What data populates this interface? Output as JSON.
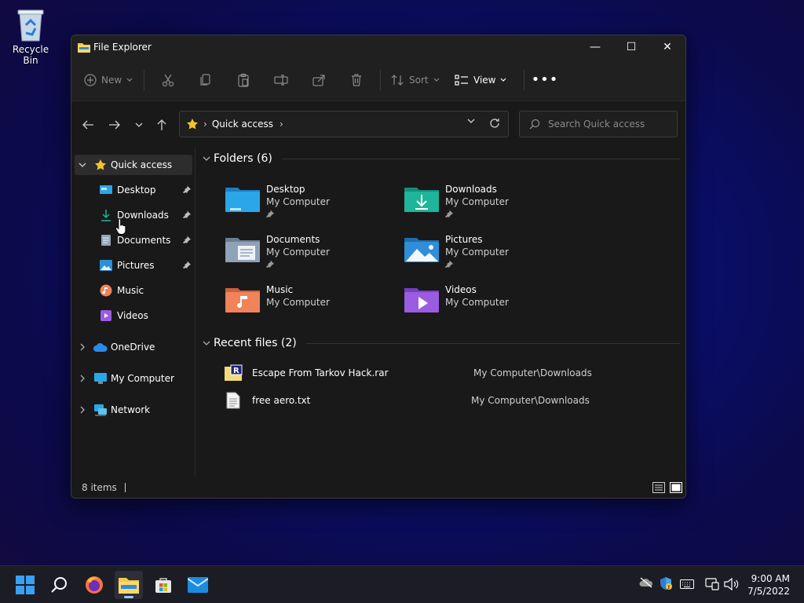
{
  "desktop": {
    "recycle_bin_label": "Recycle Bin"
  },
  "window": {
    "title": "File Explorer",
    "controls": {
      "minimize": "—",
      "maximize": "☐",
      "close": "✕"
    }
  },
  "toolbar": {
    "new_label": "New",
    "sort_label": "Sort",
    "view_label": "View",
    "more_label": "•••"
  },
  "address": {
    "crumb": "Quick access",
    "separator": "›"
  },
  "search": {
    "placeholder": "Search Quick access"
  },
  "sidebar": {
    "quick_access": "Quick access",
    "items": [
      {
        "label": "Desktop",
        "icon": "desktop-icon",
        "pinned": true
      },
      {
        "label": "Downloads",
        "icon": "download-icon",
        "pinned": true
      },
      {
        "label": "Documents",
        "icon": "documents-icon",
        "pinned": true
      },
      {
        "label": "Pictures",
        "icon": "pictures-icon",
        "pinned": true
      },
      {
        "label": "Music",
        "icon": "music-icon",
        "pinned": false
      },
      {
        "label": "Videos",
        "icon": "videos-icon",
        "pinned": false
      }
    ],
    "onedrive": "OneDrive",
    "my_computer": "My Computer",
    "network": "Network"
  },
  "folders_section": {
    "heading": "Folders (6)",
    "folders": [
      {
        "name": "Desktop",
        "location": "My Computer",
        "pinned": true,
        "color": "#2aa7e8"
      },
      {
        "name": "Downloads",
        "location": "My Computer",
        "pinned": true,
        "color": "#1fb59a"
      },
      {
        "name": "Documents",
        "location": "My Computer",
        "pinned": true,
        "color": "#8fa2b8"
      },
      {
        "name": "Pictures",
        "location": "My Computer",
        "pinned": true,
        "color": "#2f8ed8"
      },
      {
        "name": "Music",
        "location": "My Computer",
        "pinned": false,
        "color": "#f0835a"
      },
      {
        "name": "Videos",
        "location": "My Computer",
        "pinned": false,
        "color": "#9a5ce0"
      }
    ]
  },
  "recent_section": {
    "heading": "Recent files (2)",
    "files": [
      {
        "name": "Escape From Tarkov Hack.rar",
        "path": "My Computer\\Downloads"
      },
      {
        "name": "free aero.txt",
        "path": "My Computer\\Downloads"
      }
    ]
  },
  "status": {
    "items_count": "8 items"
  },
  "taskbar": {
    "time": "9:00 AM",
    "date": "7/5/2022"
  }
}
